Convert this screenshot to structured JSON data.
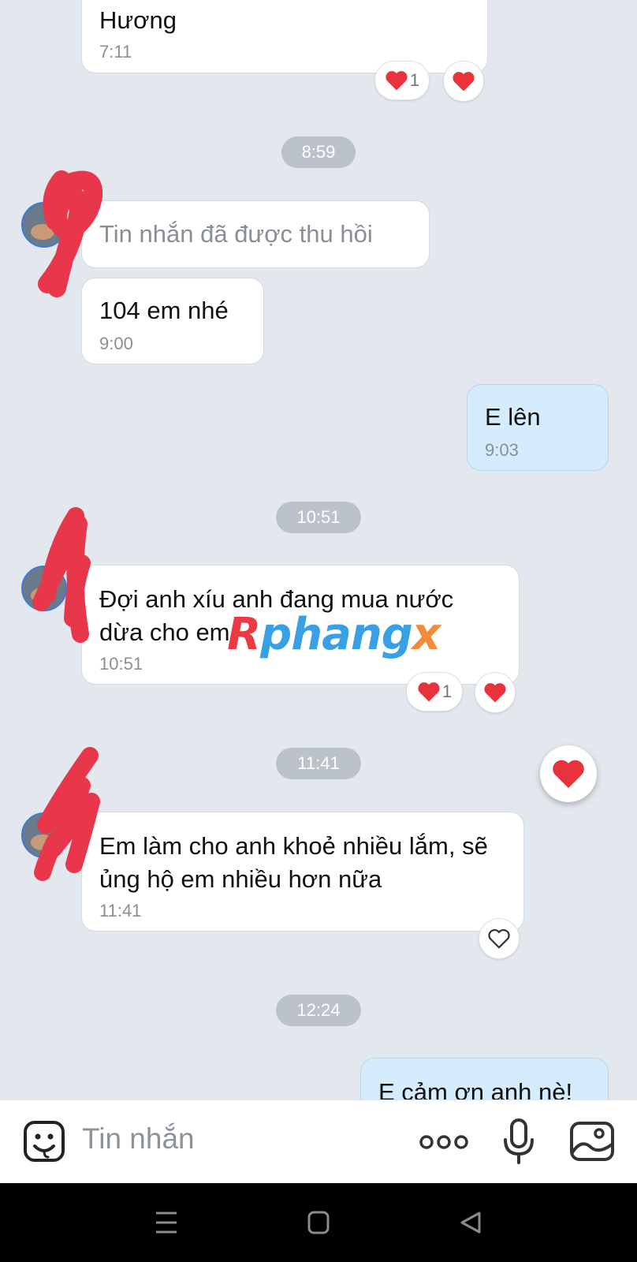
{
  "messages": [
    {
      "text": "Hương",
      "time": "7:11",
      "reaction_count": "1"
    },
    {
      "text": "Tin nhắn đã được thu hồi"
    },
    {
      "text": "104 em nhé",
      "time": "9:00"
    },
    {
      "text": "E lên",
      "time": "9:03"
    },
    {
      "text": "Đợi anh xíu anh đang mua nước dừa cho em",
      "time": "10:51",
      "reaction_count": "1"
    },
    {
      "text": "Em làm cho anh khoẻ nhiều lắm, sẽ ủng hộ em nhiều hơn nữa",
      "time": "11:41"
    },
    {
      "text": "E cảm ơn anh nè!"
    }
  ],
  "dividers": [
    "8:59",
    "10:51",
    "11:41",
    "12:24"
  ],
  "watermark": {
    "part1": "R",
    "part2": "phang",
    "part3": "x"
  },
  "input": {
    "placeholder": "Tin nhắn"
  },
  "colors": {
    "incoming": "#ffffff",
    "outgoing": "#d4ecfb",
    "background": "#e3e8ef",
    "heart": "#e8323c",
    "scribble": "#e8374a"
  },
  "icons": [
    "emoji-icon",
    "more-icon",
    "microphone-icon",
    "image-icon",
    "heart-icon",
    "menu-icon",
    "home-icon",
    "back-icon"
  ]
}
